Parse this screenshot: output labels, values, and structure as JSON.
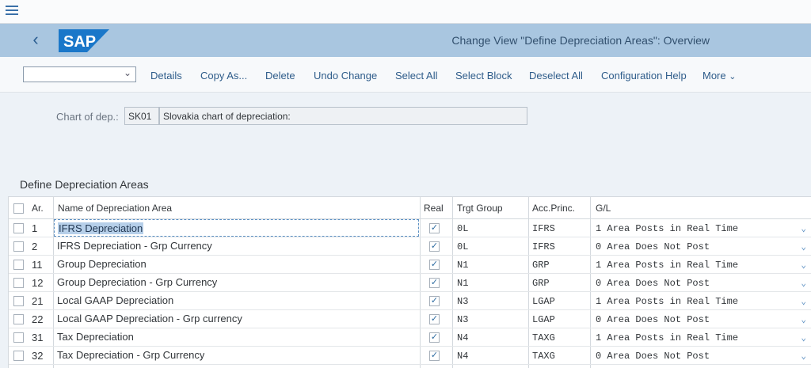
{
  "header": {
    "title": "Change View \"Define Depreciation Areas\": Overview",
    "logo_text": "SAP"
  },
  "toolbar": {
    "variant_value": "",
    "buttons": [
      "Details",
      "Copy As...",
      "Delete",
      "Undo Change",
      "Select All",
      "Select Block",
      "Deselect All",
      "Configuration Help",
      "More"
    ]
  },
  "chart": {
    "label": "Chart of dep.:",
    "code": "SK01",
    "description": "Slovakia chart of depreciation:"
  },
  "section_title": "Define Depreciation Areas",
  "table": {
    "columns": [
      "Ar.",
      "Name of Depreciation Area",
      "Real",
      "Trgt Group",
      "Acc.Princ.",
      "G/L"
    ],
    "rows": [
      {
        "ar": "1",
        "name": "IFRS Depreciation",
        "real": true,
        "group": "0L",
        "princ": "IFRS",
        "gl": "1 Area Posts in Real Time"
      },
      {
        "ar": "2",
        "name": "IFRS Depreciation - Grp Currency",
        "real": true,
        "group": "0L",
        "princ": "IFRS",
        "gl": "0 Area Does Not Post"
      },
      {
        "ar": "11",
        "name": "Group Depreciation",
        "real": true,
        "group": "N1",
        "princ": "GRP",
        "gl": "1 Area Posts in Real Time"
      },
      {
        "ar": "12",
        "name": "Group Depreciation - Grp Currency",
        "real": true,
        "group": "N1",
        "princ": "GRP",
        "gl": "0 Area Does Not Post"
      },
      {
        "ar": "21",
        "name": "Local GAAP Depreciation",
        "real": true,
        "group": "N3",
        "princ": "LGAP",
        "gl": "1 Area Posts in Real Time"
      },
      {
        "ar": "22",
        "name": "Local GAAP Depreciation - Grp currency",
        "real": true,
        "group": "N3",
        "princ": "LGAP",
        "gl": "0 Area Does Not Post"
      },
      {
        "ar": "31",
        "name": "Tax Depreciation",
        "real": true,
        "group": "N4",
        "princ": "TAXG",
        "gl": "1 Area Posts in Real Time"
      },
      {
        "ar": "32",
        "name": "Tax Depreciation - Grp Currency",
        "real": true,
        "group": "N4",
        "princ": "TAXG",
        "gl": "0 Area Does Not Post"
      }
    ]
  },
  "colors": {
    "shell": "#a9c6e0",
    "accent": "#2e5c8a",
    "selection": "#b6cfe9"
  }
}
